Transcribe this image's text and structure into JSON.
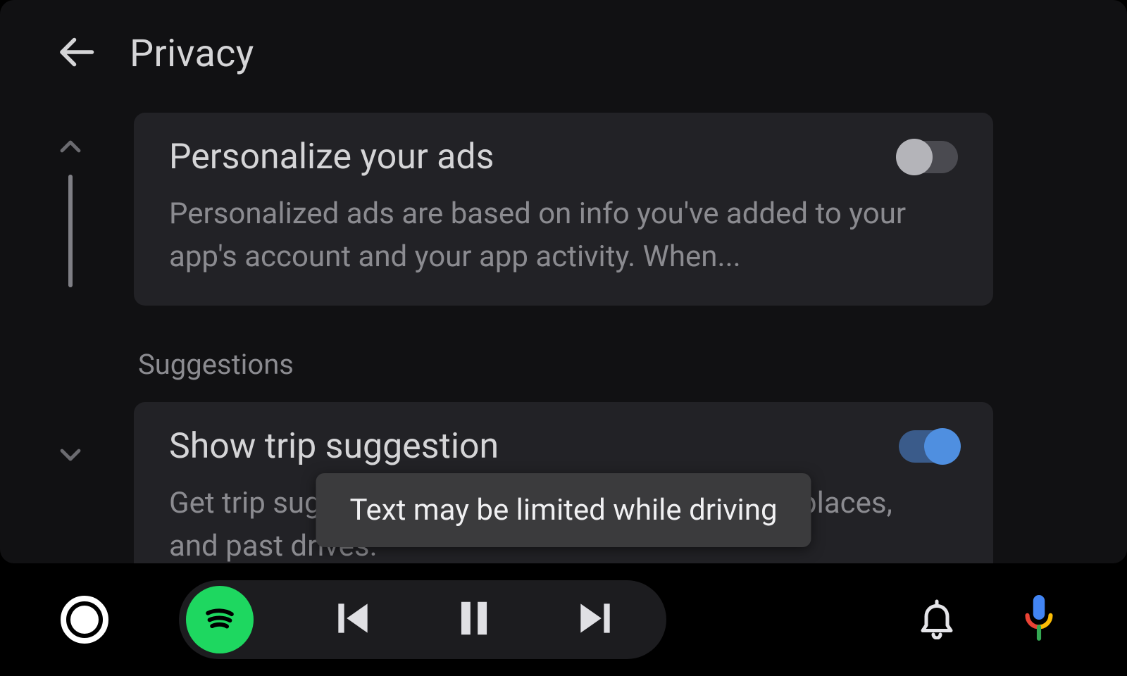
{
  "header": {
    "title": "Privacy"
  },
  "scrollbar": {
    "up_icon": "chevron-up",
    "down_icon": "chevron-down"
  },
  "settings": [
    {
      "id": "personalize-ads",
      "title": "Personalize your ads",
      "subtitle": "Personalized ads are based on info you've added to your app's account and your app activity. When...",
      "toggle": {
        "state": "off"
      }
    }
  ],
  "section_header": "Suggestions",
  "settings2": [
    {
      "id": "trip-suggestion",
      "title": "Show trip suggestion",
      "subtitle": "Get trip suggestions based on your route, saved places, and past drives.",
      "toggle": {
        "state": "on"
      }
    }
  ],
  "toast": "Text may be limited while driving",
  "navbar": {
    "assistant_icon": "assistant-circle",
    "media": {
      "source_icon": "spotify",
      "prev_icon": "skip-previous",
      "playpause_icon": "pause",
      "next_icon": "skip-next"
    },
    "bell_icon": "notifications",
    "mic_icon": "google-mic"
  }
}
